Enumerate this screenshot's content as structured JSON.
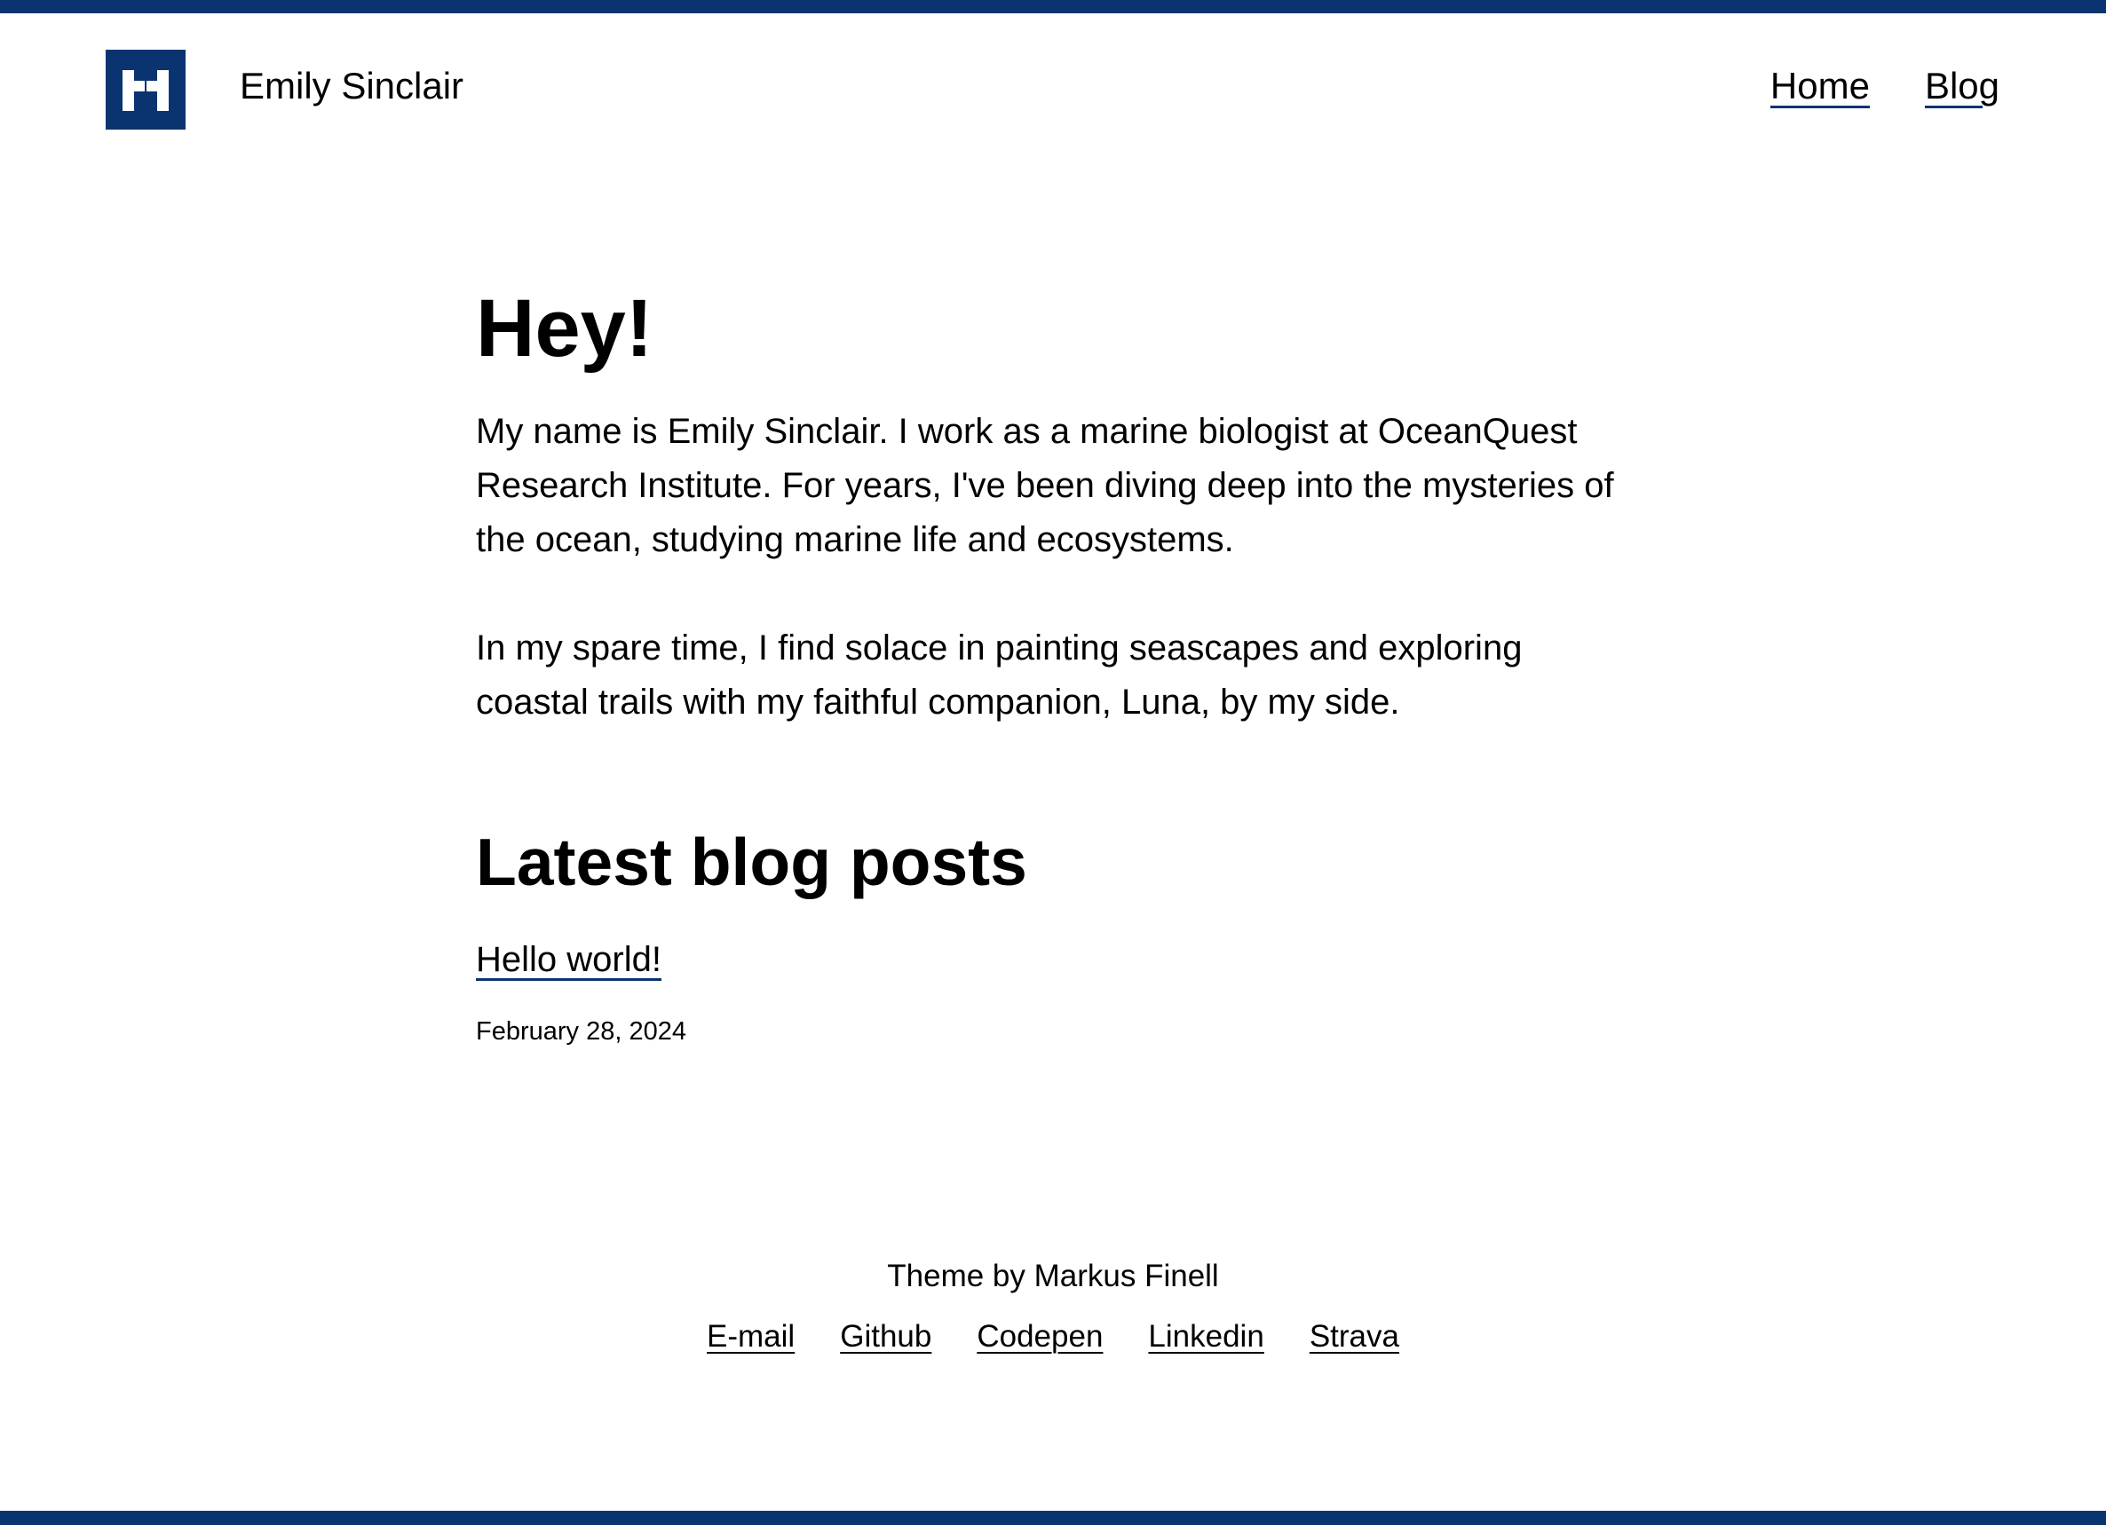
{
  "brand": {
    "accent_color": "#0a3470",
    "logo_icon": "pixel-m-logo-icon",
    "site_title": "Emily Sinclair"
  },
  "nav": {
    "items": [
      {
        "label": "Home"
      },
      {
        "label": "Blog"
      }
    ]
  },
  "intro": {
    "heading": "Hey!",
    "paragraphs": [
      "My name is Emily Sinclair. I work as a marine biologist at OceanQuest Research Institute. For years, I've been diving deep into the mysteries of the ocean, studying marine life and ecosystems.",
      "In my spare time, I find solace in painting seascapes and exploring coastal trails with my faithful companion, Luna, by my side."
    ]
  },
  "posts": {
    "heading": "Latest blog posts",
    "items": [
      {
        "title": "Hello world!",
        "date": "February 28, 2024"
      }
    ]
  },
  "footer": {
    "credit": "Theme by Markus Finell",
    "links": [
      {
        "label": "E-mail"
      },
      {
        "label": "Github"
      },
      {
        "label": "Codepen"
      },
      {
        "label": "Linkedin"
      },
      {
        "label": "Strava"
      }
    ]
  }
}
